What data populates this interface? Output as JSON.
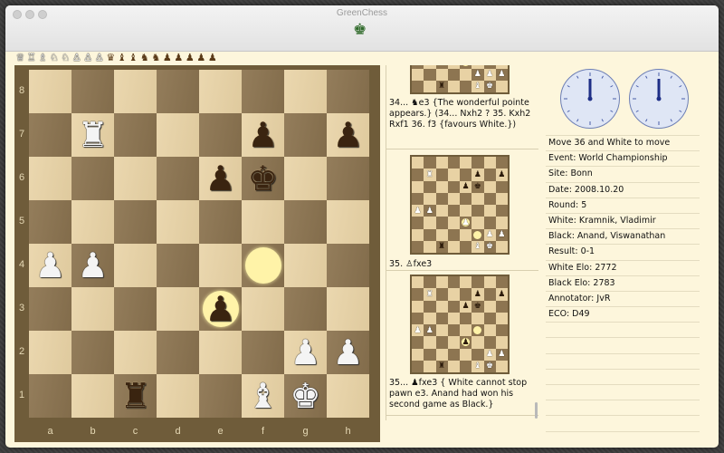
{
  "window": {
    "title": "GreenChess",
    "app_icon": "♚"
  },
  "captured": {
    "white": [
      "♕",
      "♖",
      "♗",
      "♘",
      "♘",
      "♙",
      "♙",
      "♙"
    ],
    "black": [
      "♛",
      "♝",
      "♝",
      "♞",
      "♞",
      "♟",
      "♟",
      "♟",
      "♟",
      "♟"
    ]
  },
  "board": {
    "ranks": [
      "8",
      "7",
      "6",
      "5",
      "4",
      "3",
      "2",
      "1"
    ],
    "files": [
      "a",
      "b",
      "c",
      "d",
      "e",
      "f",
      "g",
      "h"
    ],
    "colors": {
      "light": "#e8d2a4",
      "dark": "#8d7551",
      "highlight": "#fff3a8"
    },
    "highlights": [
      "f4",
      "e3"
    ],
    "pieces": [
      {
        "square": "b7",
        "glyph": "♜",
        "color": "w"
      },
      {
        "square": "f7",
        "glyph": "♟",
        "color": "b"
      },
      {
        "square": "h7",
        "glyph": "♟",
        "color": "b"
      },
      {
        "square": "e6",
        "glyph": "♟",
        "color": "b"
      },
      {
        "square": "f6",
        "glyph": "♚",
        "color": "b"
      },
      {
        "square": "a4",
        "glyph": "♟",
        "color": "w"
      },
      {
        "square": "b4",
        "glyph": "♟",
        "color": "w"
      },
      {
        "square": "e3",
        "glyph": "♟",
        "color": "b"
      },
      {
        "square": "g2",
        "glyph": "♟",
        "color": "w"
      },
      {
        "square": "h2",
        "glyph": "♟",
        "color": "w"
      },
      {
        "square": "c1",
        "glyph": "♜",
        "color": "b"
      },
      {
        "square": "f1",
        "glyph": "♝",
        "color": "w"
      },
      {
        "square": "g1",
        "glyph": "♚",
        "color": "w"
      }
    ]
  },
  "moves": {
    "entry1_text": "34... ♞e3 {The wonderful pointe appears.} (34... Nxh2 ? 35. Kxh2 Rxf1 36. f3 {favours White.})",
    "entry2_text": "35. ♙fxe3",
    "entry3_text": "35... ♟fxe3 { White cannot stop pawn e3. Anand had won his second game as Black.}"
  },
  "clocks": {
    "white_time": "12:00",
    "black_time": "12:00"
  },
  "info": {
    "status": "Move 36 and White to move",
    "event": "Event:  World Championship",
    "site": "Site:  Bonn",
    "date": "Date:  2008.10.20",
    "round": "Round:  5",
    "white": "White:  Kramnik, Vladimir",
    "black": "Black:  Anand, Viswanathan",
    "result": "Result:  0-1",
    "white_elo": "White Elo:  2772",
    "black_elo": "Black Elo:  2783",
    "annotator": "Annotator:  JvR",
    "eco": "ECO:  D49"
  }
}
